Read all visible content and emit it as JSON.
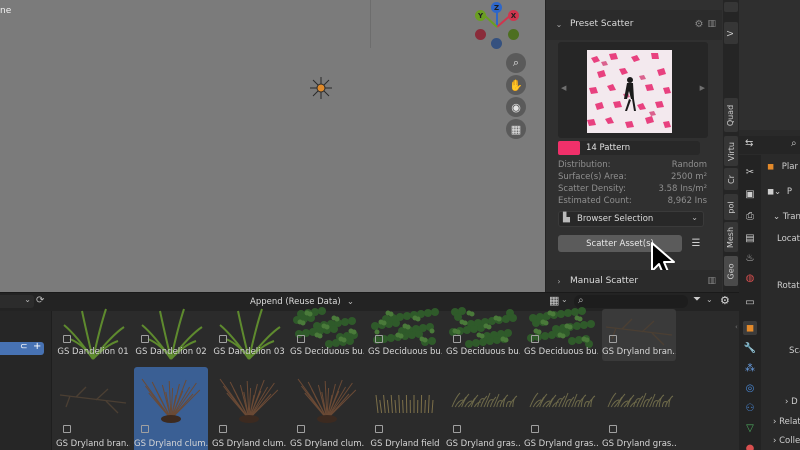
{
  "viewport": {
    "mode_label_fragment": "ne",
    "gizmo": {
      "x": "X",
      "y": "Y",
      "z": "Z"
    },
    "nav_icons": [
      "zoom-icon",
      "hand-pan-icon",
      "camera-icon",
      "grid-icon"
    ]
  },
  "npanel": {
    "preset_header": "Preset Scatter",
    "preset_name": "14 Pattern",
    "preset_color": "#f0306a",
    "stats": [
      {
        "label": "Distribution:",
        "value": "Random"
      },
      {
        "label": "Surface(s) Area:",
        "value": "2500 m²"
      },
      {
        "label": "Scatter Density:",
        "value": "3.58 Ins/m²"
      },
      {
        "label": "Estimated Count:",
        "value": "8,962 Ins"
      }
    ],
    "selection_dropdown": "Browser Selection",
    "scatter_button": "Scatter Asset(s)",
    "manual_header": "Manual Scatter"
  },
  "vtabs": [
    "V",
    "Quad",
    "Virtu",
    "Cr",
    "pol",
    "Mesh",
    "Geo"
  ],
  "properties": {
    "obj_name": "Plar",
    "obj_field": "P",
    "sections": [
      "Trans",
      "Locati",
      "Rotati",
      "Sca",
      "D",
      "Relat",
      "Colle"
    ]
  },
  "assets": {
    "import_mode": "Append (Reuse Data)",
    "row1": [
      "GS Dandelion 01",
      "GS Dandelion 02",
      "GS Dandelion 03",
      "GS Deciduous bu...",
      "GS Deciduous bu...",
      "GS Deciduous bu...",
      "GS Deciduous bu...",
      "GS Dryland bran..."
    ],
    "row2": [
      "GS Dryland bran...",
      "GS Dryland clum...",
      "GS Dryland clum...",
      "GS Dryland clum...",
      "GS Dryland field",
      "GS Dryland gras...",
      "GS Dryland gras...",
      "GS Dryland gras..."
    ],
    "selected_tile": "GS Dryland clum..."
  },
  "colors": {
    "accent": "#4772b3",
    "viewport": "#7b7b7b",
    "panel": "#303030"
  }
}
